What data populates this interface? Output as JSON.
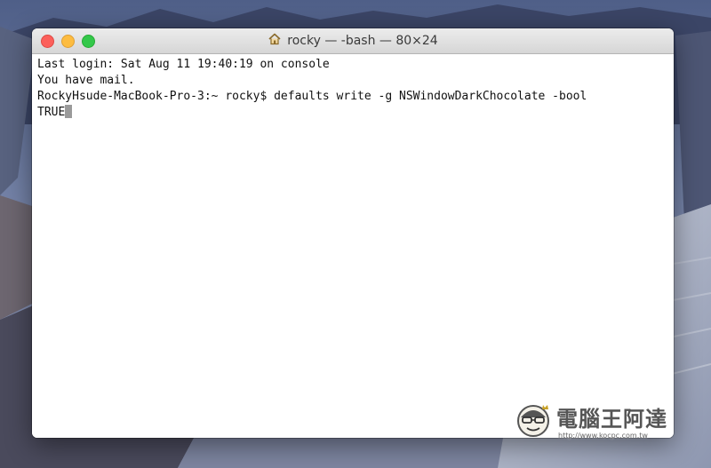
{
  "window": {
    "title": "rocky — -bash — 80×24",
    "title_icon": "home-icon",
    "traffic_lights": {
      "close_color": "#fc605b",
      "minimize_color": "#fdbc40",
      "zoom_color": "#34c84a"
    }
  },
  "terminal": {
    "lines": [
      "Last login: Sat Aug 11 19:40:19 on console",
      "You have mail.",
      "RockyHsude-MacBook-Pro-3:~ rocky$ defaults write -g NSWindowDarkChocolate -bool",
      "TRUE"
    ],
    "cursor_icon": "block-cursor"
  },
  "watermark": {
    "text": "電腦王阿達",
    "url": "http://www.kocpc.com.tw"
  }
}
